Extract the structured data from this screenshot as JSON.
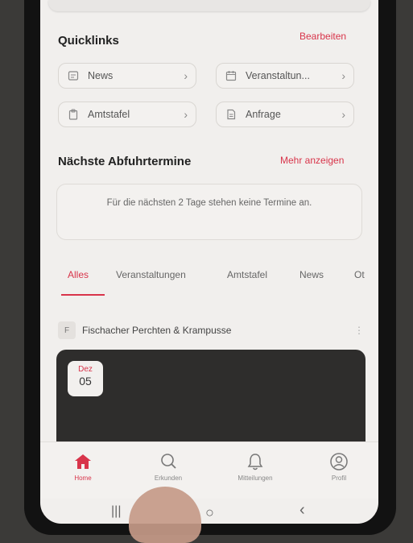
{
  "quicklinks": {
    "title": "Quicklinks",
    "edit_label": "Bearbeiten",
    "items": [
      {
        "label": "News",
        "icon": "newspaper-icon"
      },
      {
        "label": "Veranstaltun...",
        "icon": "calendar-icon"
      },
      {
        "label": "Amtstafel",
        "icon": "clipboard-icon"
      },
      {
        "label": "Anfrage",
        "icon": "document-icon"
      }
    ]
  },
  "collections": {
    "title": "Nächste Abfuhrtermine",
    "more_label": "Mehr anzeigen",
    "empty_message": "Für die nächsten 2 Tage stehen keine Termine an."
  },
  "tabs": {
    "items": [
      "Alles",
      "Veranstaltungen",
      "Amtstafel",
      "News",
      "Ot"
    ],
    "active_index": 0
  },
  "feed": {
    "badge": "F",
    "source_title": "Fischacher Perchten & Krampusse",
    "event": {
      "month": "Dez",
      "day": "05"
    }
  },
  "bottom_nav": {
    "items": [
      {
        "label": "Home",
        "icon": "home-icon"
      },
      {
        "label": "Erkunden",
        "icon": "search-icon"
      },
      {
        "label": "Mitteilungen",
        "icon": "bell-icon"
      },
      {
        "label": "Profil",
        "icon": "user-icon"
      }
    ],
    "active_index": 0
  },
  "system_nav": {
    "recents": "|||",
    "home": "○",
    "back": "‹"
  },
  "colors": {
    "accent": "#d8344a",
    "background": "#f1efed",
    "card_dark": "#2e2d2c"
  }
}
